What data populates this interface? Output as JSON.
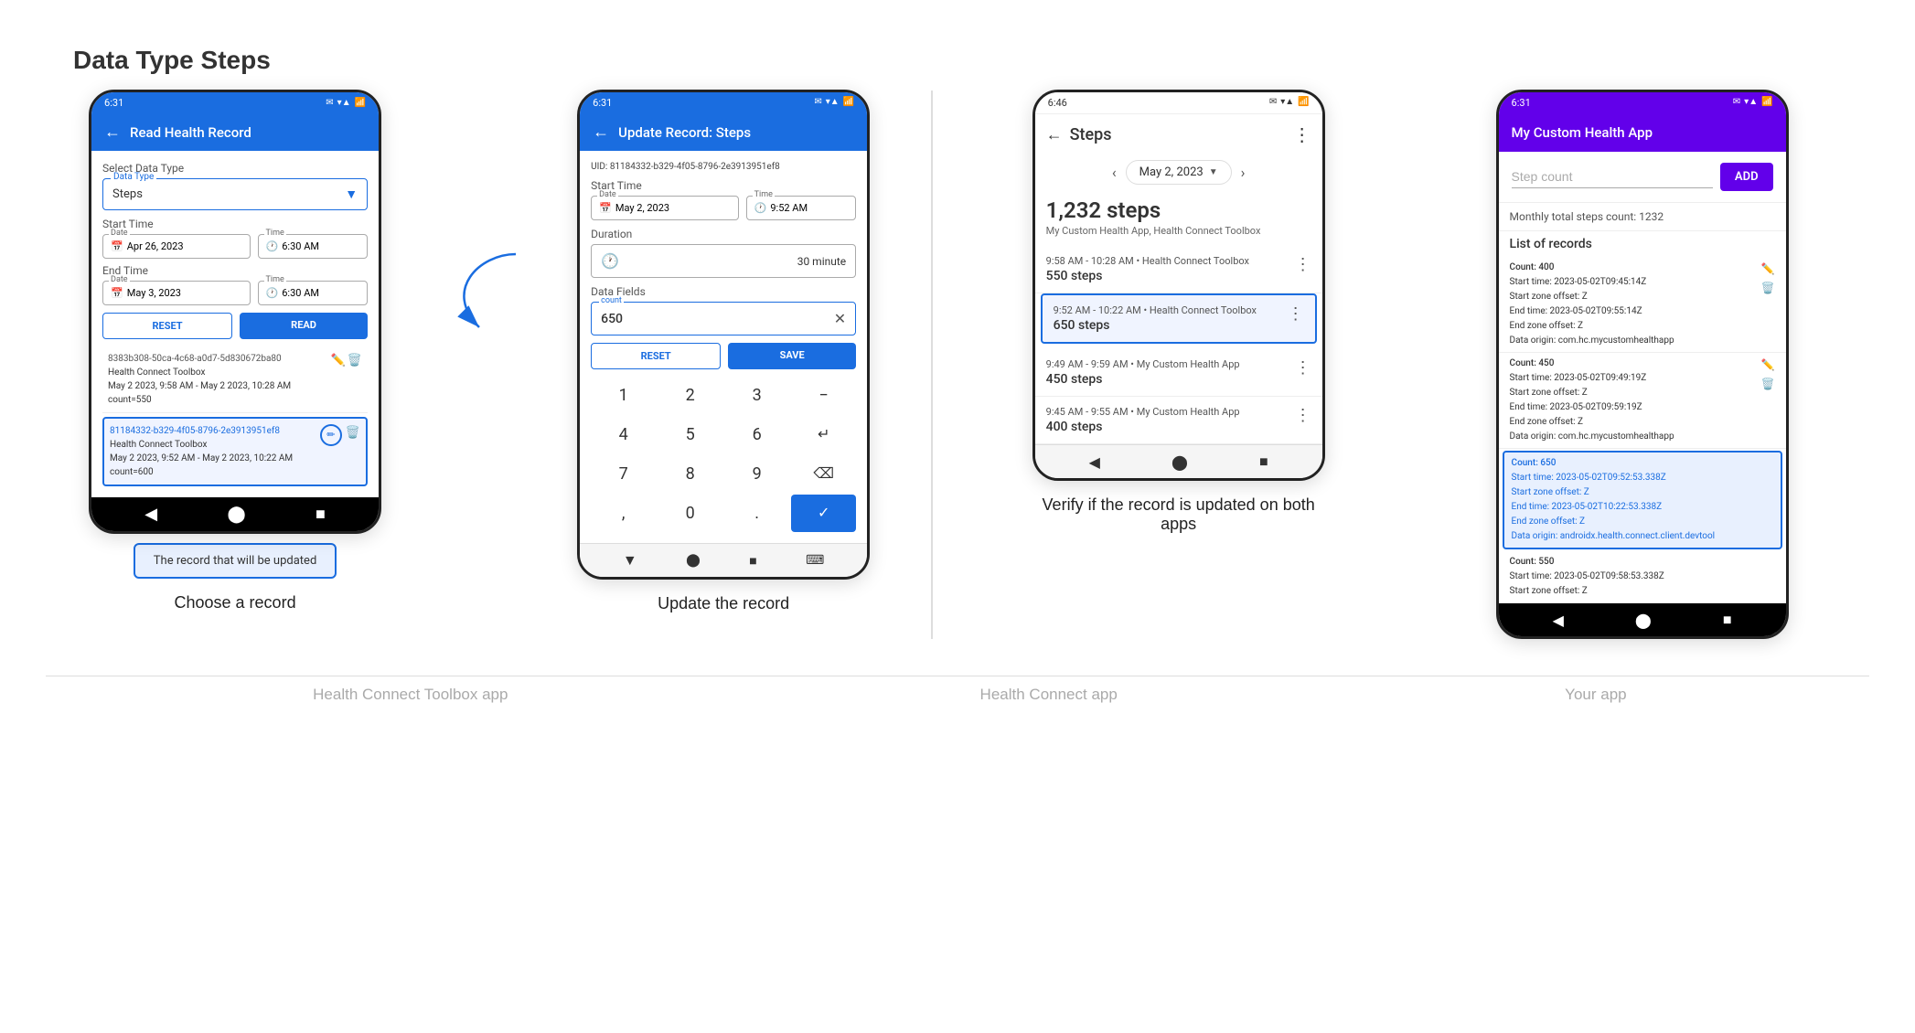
{
  "page_title": "Data Type Steps",
  "phones": [
    {
      "id": "phone1",
      "status_time": "6:31",
      "status_icons": "▾▲",
      "header_bg": "blue",
      "header_title": "Read Health Record",
      "select_label": "Select Data Type",
      "data_type_label": "Data Type",
      "data_type_value": "Steps",
      "start_time_label": "Start Time",
      "start_date_label": "Date",
      "start_date_value": "Apr 26, 2023",
      "start_time_field_label": "Time",
      "start_time_value": "6:30 AM",
      "end_time_label": "End Time",
      "end_date_value": "May 3, 2023",
      "end_time_value": "6:30 AM",
      "btn_reset": "RESET",
      "btn_read": "READ",
      "records": [
        {
          "id": "8383b308",
          "uid_short": "8383b308-50ca-4c68-a0d7-5d830672ba80",
          "source": "Health Connect Toolbox",
          "date_range": "May 2 2023, 9:58 AM - May 2 2023, 10:28 AM",
          "count": "count=550",
          "selected": false
        },
        {
          "id": "81184332",
          "uid_short": "81184332-b329-4f05-8796-2e3913951ef8",
          "source": "Health Connect Toolbox",
          "date_range": "May 2 2023, 9:52 AM - May 2 2023, 10:22 AM",
          "count": "count=600",
          "selected": true
        }
      ],
      "callout": "The record that will be updated"
    },
    {
      "id": "phone2",
      "status_time": "6:31",
      "header_bg": "blue",
      "header_title": "Update Record: Steps",
      "uid_label": "UID:",
      "uid_value": "81184332-b329-4f05-8796-2e3913951ef8",
      "start_time_label": "Start Time",
      "start_date_value": "May 2, 2023",
      "start_time_value": "9:52 AM",
      "duration_label": "Duration",
      "duration_value": "30 minute",
      "data_fields_label": "Data Fields",
      "count_label": "count",
      "count_value": "650",
      "btn_reset": "RESET",
      "btn_save": "SAVE",
      "numpad": [
        "1",
        "2",
        "3",
        "−",
        "4",
        "5",
        "6",
        "↵",
        "7",
        "8",
        "9",
        "⌫",
        ",",
        "0",
        ".",
        "✓"
      ]
    },
    {
      "id": "phone3",
      "status_time": "6:46",
      "header_title": "Steps",
      "date_nav": "May 2, 2023",
      "total_steps": "1,232 steps",
      "total_source": "My Custom Health App, Health Connect Toolbox",
      "records": [
        {
          "time": "9:58 AM - 10:28 AM • Health Connect Toolbox",
          "steps": "550 steps",
          "highlighted": false
        },
        {
          "time": "9:52 AM - 10:22 AM • Health Connect Toolbox",
          "steps": "650 steps",
          "highlighted": true
        },
        {
          "time": "9:49 AM - 9:59 AM • My Custom Health App",
          "steps": "450 steps",
          "highlighted": false
        },
        {
          "time": "9:45 AM - 9:55 AM • My Custom Health App",
          "steps": "400 steps",
          "highlighted": false
        }
      ]
    },
    {
      "id": "phone4",
      "status_time": "6:31",
      "header_bg": "purple",
      "header_title": "My Custom Health App",
      "step_input_placeholder": "Step count",
      "add_btn_label": "ADD",
      "monthly_total": "Monthly total steps count: 1232",
      "list_header": "List of records",
      "records": [
        {
          "count": "Count: 400",
          "start_time": "Start time: 2023-05-02T09:45:14Z",
          "start_zone": "Start zone offset: Z",
          "end_time": "End time: 2023-05-02T09:55:14Z",
          "end_zone": "End zone offset: Z",
          "data_origin": "Data origin: com.hc.mycustomhealthapp",
          "highlighted": false
        },
        {
          "count": "Count: 450",
          "start_time": "Start time: 2023-05-02T09:49:19Z",
          "start_zone": "Start zone offset: Z",
          "end_time": "End time: 2023-05-02T09:59:19Z",
          "end_zone": "End zone offset: Z",
          "data_origin": "Data origin: com.hc.mycustomhealthapp",
          "highlighted": false
        },
        {
          "count": "Count: 650",
          "start_time": "Start time: 2023-05-02T09:52:53.338Z",
          "start_zone": "Start zone offset: Z",
          "end_time": "End time: 2023-05-02T10:22:53.338Z",
          "end_zone": "End zone offset: Z",
          "data_origin": "Data origin: androidx.health.connect.client.devtool",
          "highlighted": true
        },
        {
          "count": "Count: 550",
          "start_time": "Start time: 2023-05-02T09:58:53.338Z",
          "start_zone": "Start zone offset: Z",
          "end_time": "",
          "end_zone": "",
          "data_origin": "",
          "highlighted": false
        }
      ]
    }
  ],
  "captions": {
    "phone1": "Choose a record",
    "phone2": "Update the record",
    "phone3": "Verify if the record is updated on both apps",
    "phone3_sub": "",
    "phone4": ""
  },
  "bottom_labels": {
    "left": "Health Connect Toolbox  app",
    "mid": "Health Connect app",
    "right": "Your app"
  },
  "step_count_label": "Step count"
}
